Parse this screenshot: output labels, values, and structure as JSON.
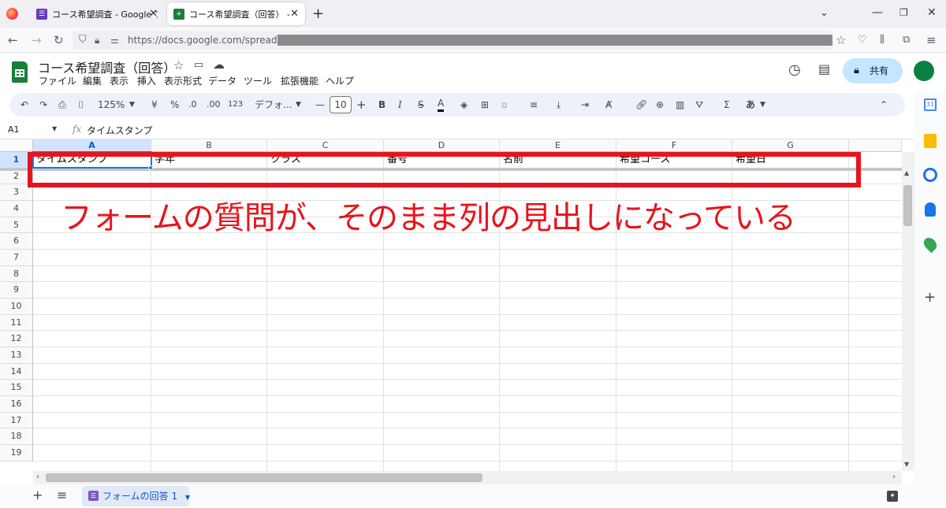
{
  "browser": {
    "tabs": [
      {
        "title": "コース希望調査 - Google フォーム",
        "color": "#673ab7"
      },
      {
        "title": "コース希望調査（回答） - Google",
        "color": "#188038"
      }
    ],
    "url": "https://docs.google.com/spreadsheets/"
  },
  "doc": {
    "title": "コース希望調査（回答）",
    "share_label": "共有",
    "menu": [
      "ファイル",
      "編集",
      "表示",
      "挿入",
      "表示形式",
      "データ",
      "ツール",
      "拡張機能",
      "ヘルプ"
    ]
  },
  "toolbar": {
    "zoom": "125%",
    "currency": "¥",
    "percent": "%",
    "dec_decrease": ".0",
    "dec_increase": ".00",
    "number_format": "123",
    "font": "デフォ...",
    "font_size": "10",
    "bold": "B",
    "italic": "I",
    "strike": "S",
    "text_color": "A",
    "input_tools": "あ"
  },
  "formula": {
    "cell_ref": "A1",
    "fx": "fx",
    "content": "タイムスタンプ"
  },
  "grid": {
    "columns": [
      "A",
      "B",
      "C",
      "D",
      "E",
      "F",
      "G"
    ],
    "rows": [
      "1",
      "2",
      "3",
      "4",
      "5",
      "6",
      "7",
      "8",
      "9",
      "10",
      "11",
      "12",
      "13",
      "14",
      "15",
      "16",
      "17",
      "18",
      "19"
    ],
    "row1": [
      "タイムスタンプ",
      "学年",
      "クラス",
      "番号",
      "名前",
      "希望コース",
      "希望日"
    ]
  },
  "annotation": {
    "text": "フォームの質問が、そのまま列の見出しになっている",
    "color": "#e8141c"
  },
  "sheet_tab": {
    "label": "フォームの回答 1"
  },
  "colors": {
    "accent": "#0b57d0",
    "sheets_green": "#188038",
    "share_bg": "#c2e7ff",
    "avatar": "#0b8043"
  }
}
